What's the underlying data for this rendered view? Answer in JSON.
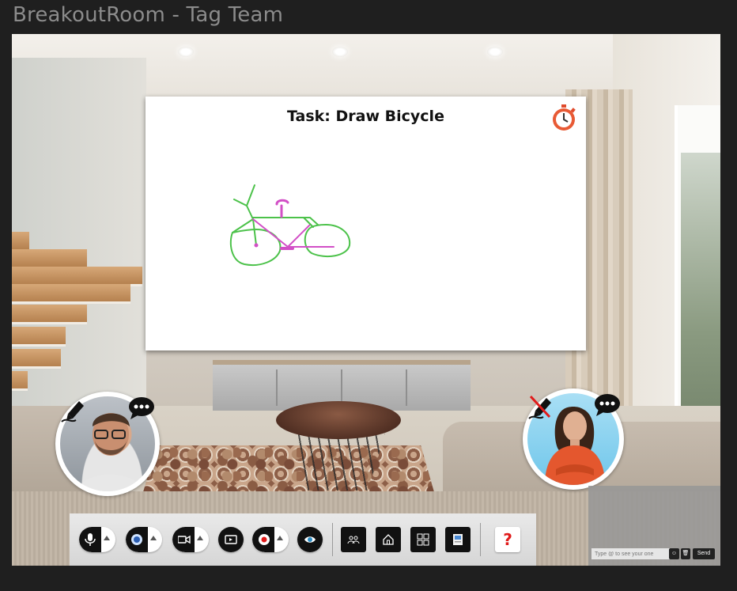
{
  "window": {
    "title": "BreakoutRoom - Tag Team"
  },
  "whiteboard": {
    "task_title": "Task: Draw Bicycle",
    "timer_icon": "stopwatch-icon",
    "drawing_colors": {
      "frame": "#4cc24a",
      "parts": "#d24fc6"
    }
  },
  "participants": [
    {
      "role": "drawing",
      "name_hidden": true,
      "pen_icon": "pen-icon",
      "chat_icon": "chat-bubble-icon"
    },
    {
      "role": "not-drawing",
      "name_hidden": true,
      "pen_icon": "pen-disabled-icon",
      "chat_icon": "chat-bubble-icon"
    }
  ],
  "toolbar": {
    "buttons": [
      {
        "name": "microphone-button",
        "icon": "microphone-icon",
        "has_menu": true
      },
      {
        "name": "camera-select-button",
        "icon": "webcam-icon",
        "has_menu": true
      },
      {
        "name": "video-button",
        "icon": "video-camera-icon",
        "has_menu": true
      },
      {
        "name": "screen-share-button",
        "icon": "screen-share-icon",
        "has_menu": false
      },
      {
        "name": "record-button",
        "icon": "record-icon",
        "has_menu": true
      },
      {
        "name": "view-button",
        "icon": "eye-icon",
        "has_menu": false
      },
      {
        "name": "people-button",
        "icon": "people-icon"
      },
      {
        "name": "home-button",
        "icon": "home-icon"
      },
      {
        "name": "rooms-button",
        "icon": "rooms-icon"
      },
      {
        "name": "board-button",
        "icon": "board-icon"
      },
      {
        "name": "help-button",
        "label": "?"
      }
    ],
    "accent": "#e01b1b"
  },
  "chat": {
    "placeholder": "Type @ to see your one",
    "emoji_label": "☺",
    "delete_label": "🗑",
    "send_label": "Send"
  }
}
